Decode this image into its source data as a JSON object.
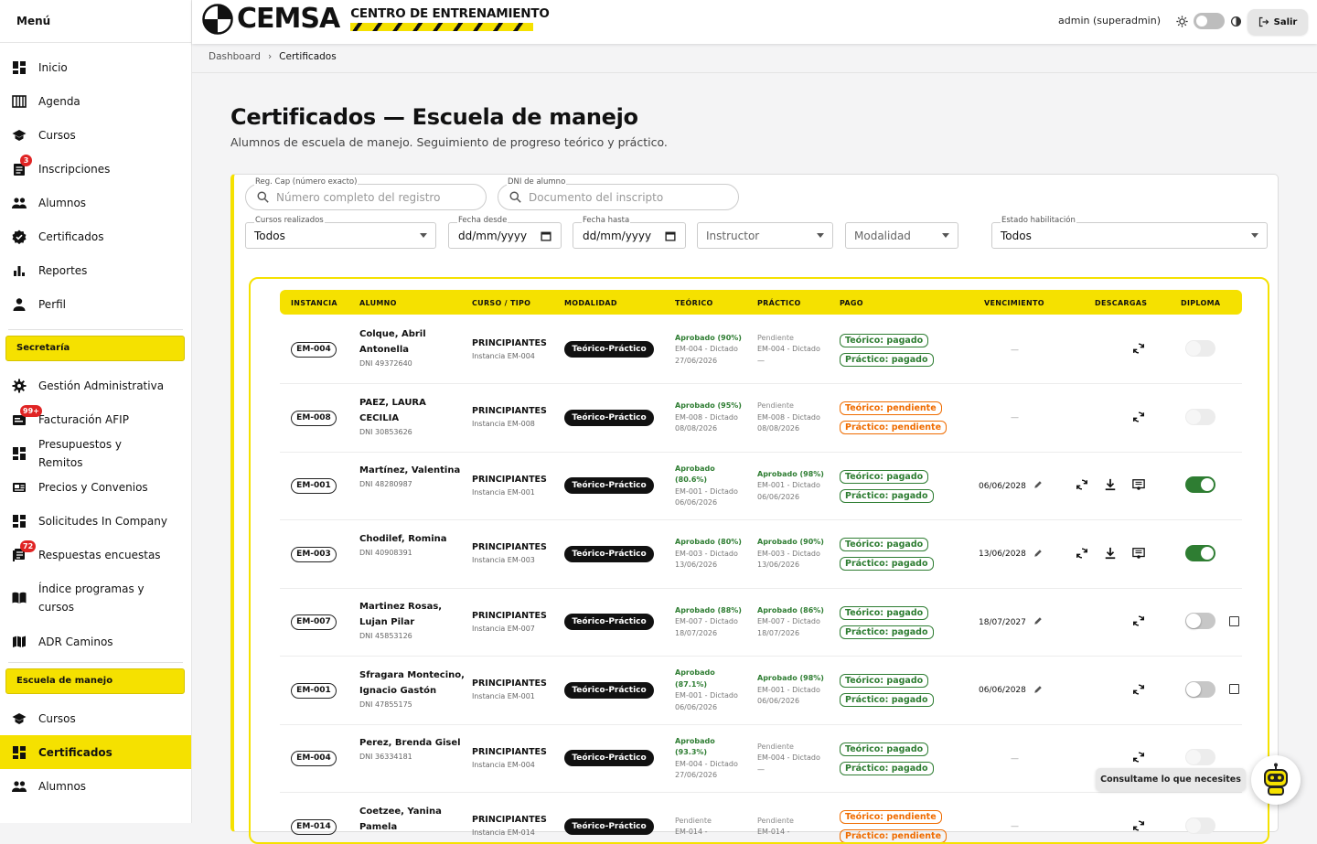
{
  "sidebar": {
    "title": "Menú",
    "main": [
      {
        "label": "Inicio",
        "icon": "dashboard-icon"
      },
      {
        "label": "Agenda",
        "icon": "calendar-icon"
      },
      {
        "label": "Cursos",
        "icon": "school-icon"
      },
      {
        "label": "Inscripciones",
        "icon": "assignment-icon",
        "badge": "3"
      },
      {
        "label": "Alumnos",
        "icon": "people-icon"
      },
      {
        "label": "Certificados",
        "icon": "verified-icon"
      },
      {
        "label": "Reportes",
        "icon": "bar-chart-icon"
      },
      {
        "label": "Perfil",
        "icon": "person-icon"
      }
    ],
    "secretaria_title": "Secretaría",
    "secretaria": [
      {
        "label": "Gestión Administrativa",
        "icon": "settings-icon"
      },
      {
        "label": "Facturación AFIP",
        "icon": "receipt-icon",
        "badge": "99+"
      },
      {
        "label": "Presupuestos y Remitos",
        "icon": "grid-icon"
      },
      {
        "label": "Precios y Convenios",
        "icon": "price-icon"
      },
      {
        "label": "Solicitudes In Company",
        "icon": "grid-icon"
      },
      {
        "label": "Respuestas encuestas",
        "icon": "survey-icon",
        "badge": "72"
      },
      {
        "label": "Índice programas y cursos",
        "icon": "book-icon"
      },
      {
        "label": "ADR Caminos",
        "icon": "map-icon"
      }
    ],
    "escuela_title": "Escuela de manejo",
    "escuela": [
      {
        "label": "Cursos",
        "icon": "school-icon"
      },
      {
        "label": "Certificados",
        "icon": "grid-icon",
        "active": true
      },
      {
        "label": "Alumnos",
        "icon": "people-icon"
      }
    ]
  },
  "header": {
    "brand": "CEMSA",
    "brand_sub": "CENTRO DE ENTRENAMIENTO",
    "user": "admin (superadmin)",
    "exit_label": "Salir"
  },
  "breadcrumb": {
    "root": "Dashboard",
    "current": "Certificados"
  },
  "page": {
    "title": "Certificados — Escuela de manejo",
    "subtitle": "Alumnos de escuela de manejo. Seguimiento de progreso teórico y práctico."
  },
  "filters": {
    "regcap_label": "Reg. Cap (número exacto)",
    "regcap_placeholder": "Número completo del registro",
    "dni_label": "DNI de alumno",
    "dni_placeholder": "Documento del inscripto",
    "cursos_label": "Cursos realizados",
    "cursos_value": "Todos",
    "desde_label": "Fecha desde",
    "desde_value": "dd/mm/yyyy",
    "hasta_label": "Fecha hasta",
    "hasta_value": "dd/mm/yyyy",
    "instructor_value": "Instructor",
    "modalidad_value": "Modalidad",
    "estado_label": "Estado habilitación",
    "estado_value": "Todos"
  },
  "table": {
    "headers": [
      "INSTANCIA",
      "ALUMNO",
      "CURSO / TIPO",
      "MODALIDAD",
      "TEÓRICO",
      "PRÁCTICO",
      "PAGO",
      "VENCIMIENTO",
      "DESCARGAS",
      "DIPLOMA"
    ],
    "rows": [
      {
        "inst": "EM-004",
        "name": "Colque, Abril Antonella",
        "dni": "DNI 49372640",
        "curso": "PRINCIPIANTES",
        "cinst": "Instancia EM-004",
        "mod": "Teórico-Práctico",
        "teo_status": "Aprobado (90%)",
        "teo_ok": true,
        "teo_info": "EM-004 - Dictado 27/06/2026",
        "pra_status": "Pendiente",
        "pra_ok": false,
        "pra_info": "EM-004 - Dictado —",
        "pago": [
          {
            "t": "Teórico: pagado",
            "ok": true
          },
          {
            "t": "Práctico: pagado",
            "ok": true
          }
        ],
        "venc": "—",
        "dl": 1,
        "dip": "dis"
      },
      {
        "inst": "EM-008",
        "name": "PAEZ, LAURA CECILIA",
        "dni": "DNI 30853626",
        "curso": "PRINCIPIANTES",
        "cinst": "Instancia EM-008",
        "mod": "Teórico-Práctico",
        "teo_status": "Aprobado (95%)",
        "teo_ok": true,
        "teo_info": "EM-008 - Dictado 08/08/2026",
        "pra_status": "Pendiente",
        "pra_ok": false,
        "pra_info": "EM-008 - Dictado 08/08/2026",
        "pago": [
          {
            "t": "Teórico: pendiente",
            "ok": false
          },
          {
            "t": "Práctico: pendiente",
            "ok": false
          }
        ],
        "venc": "—",
        "dl": 1,
        "dip": "dis"
      },
      {
        "inst": "EM-001",
        "name": "Martínez, Valentina",
        "dni": "DNI 48280987",
        "curso": "PRINCIPIANTES",
        "cinst": "Instancia EM-001",
        "mod": "Teórico-Práctico",
        "teo_status": "Aprobado (80.6%)",
        "teo_ok": true,
        "teo_info": "EM-001 - Dictado 06/06/2026",
        "pra_status": "Aprobado (98%)",
        "pra_ok": true,
        "pra_info": "EM-001 - Dictado 06/06/2026",
        "pago": [
          {
            "t": "Teórico: pagado",
            "ok": true
          },
          {
            "t": "Práctico: pagado",
            "ok": true
          }
        ],
        "venc": "06/06/2028",
        "dl": 3,
        "dip": "on"
      },
      {
        "inst": "EM-003",
        "name": "Chodilef, Romina",
        "dni": "DNI 40908391",
        "curso": "PRINCIPIANTES",
        "cinst": "Instancia EM-003",
        "mod": "Teórico-Práctico",
        "teo_status": "Aprobado (80%)",
        "teo_ok": true,
        "teo_info": "EM-003 - Dictado 13/06/2026",
        "pra_status": "Aprobado (90%)",
        "pra_ok": true,
        "pra_info": "EM-003 - Dictado 13/06/2026",
        "pago": [
          {
            "t": "Teórico: pagado",
            "ok": true
          },
          {
            "t": "Práctico: pagado",
            "ok": true
          }
        ],
        "venc": "13/06/2028",
        "dl": 3,
        "dip": "on"
      },
      {
        "inst": "EM-007",
        "name": "Martinez Rosas, Lujan Pilar",
        "dni": "DNI 45853126",
        "curso": "PRINCIPIANTES",
        "cinst": "Instancia EM-007",
        "mod": "Teórico-Práctico",
        "teo_status": "Aprobado (88%)",
        "teo_ok": true,
        "teo_info": "EM-007 - Dictado 18/07/2026",
        "pra_status": "Aprobado (86%)",
        "pra_ok": true,
        "pra_info": "EM-007 - Dictado 18/07/2026",
        "pago": [
          {
            "t": "Teórico: pagado",
            "ok": true
          },
          {
            "t": "Práctico: pagado",
            "ok": true
          }
        ],
        "venc": "18/07/2027",
        "dl": 1,
        "dip": "off"
      },
      {
        "inst": "EM-001",
        "name": "Sfragara Montecino, Ignacio Gastón",
        "dni": "DNI 47855175",
        "curso": "PRINCIPIANTES",
        "cinst": "Instancia EM-001",
        "mod": "Teórico-Práctico",
        "teo_status": "Aprobado (87.1%)",
        "teo_ok": true,
        "teo_info": "EM-001 - Dictado 06/06/2026",
        "pra_status": "Aprobado (98%)",
        "pra_ok": true,
        "pra_info": "EM-001 - Dictado 06/06/2026",
        "pago": [
          {
            "t": "Teórico: pagado",
            "ok": true
          },
          {
            "t": "Práctico: pagado",
            "ok": true
          }
        ],
        "venc": "06/06/2028",
        "dl": 1,
        "dip": "off"
      },
      {
        "inst": "EM-004",
        "name": "Perez, Brenda Gisel",
        "dni": "DNI 36334181",
        "curso": "PRINCIPIANTES",
        "cinst": "Instancia EM-004",
        "mod": "Teórico-Práctico",
        "teo_status": "Aprobado (93.3%)",
        "teo_ok": true,
        "teo_info": "EM-004 - Dictado 27/06/2026",
        "pra_status": "Pendiente",
        "pra_ok": false,
        "pra_info": "EM-004 - Dictado —",
        "pago": [
          {
            "t": "Teórico: pagado",
            "ok": true
          },
          {
            "t": "Práctico: pagado",
            "ok": true
          }
        ],
        "venc": "—",
        "dl": 1,
        "dip": "dis"
      },
      {
        "inst": "EM-014",
        "name": "Coetzee, Yanina Pamela",
        "dni": "",
        "curso": "PRINCIPIANTES",
        "cinst": "Instancia EM-014",
        "mod": "Teórico-Práctico",
        "teo_status": "Pendiente",
        "teo_ok": false,
        "teo_info": "EM-014 -",
        "pra_status": "Pendiente",
        "pra_ok": false,
        "pra_info": "EM-014 -",
        "pago": [
          {
            "t": "Teórico: pendiente",
            "ok": false
          },
          {
            "t": "Práctico: pendiente",
            "ok": false
          }
        ],
        "venc": "—",
        "dl": 1,
        "dip": "dis"
      }
    ]
  },
  "chat": {
    "label": "Consultame lo que necesites"
  },
  "colors": {
    "accent": "#f5e100",
    "ok": "#2e7d32",
    "pending": "#ef6c00"
  }
}
